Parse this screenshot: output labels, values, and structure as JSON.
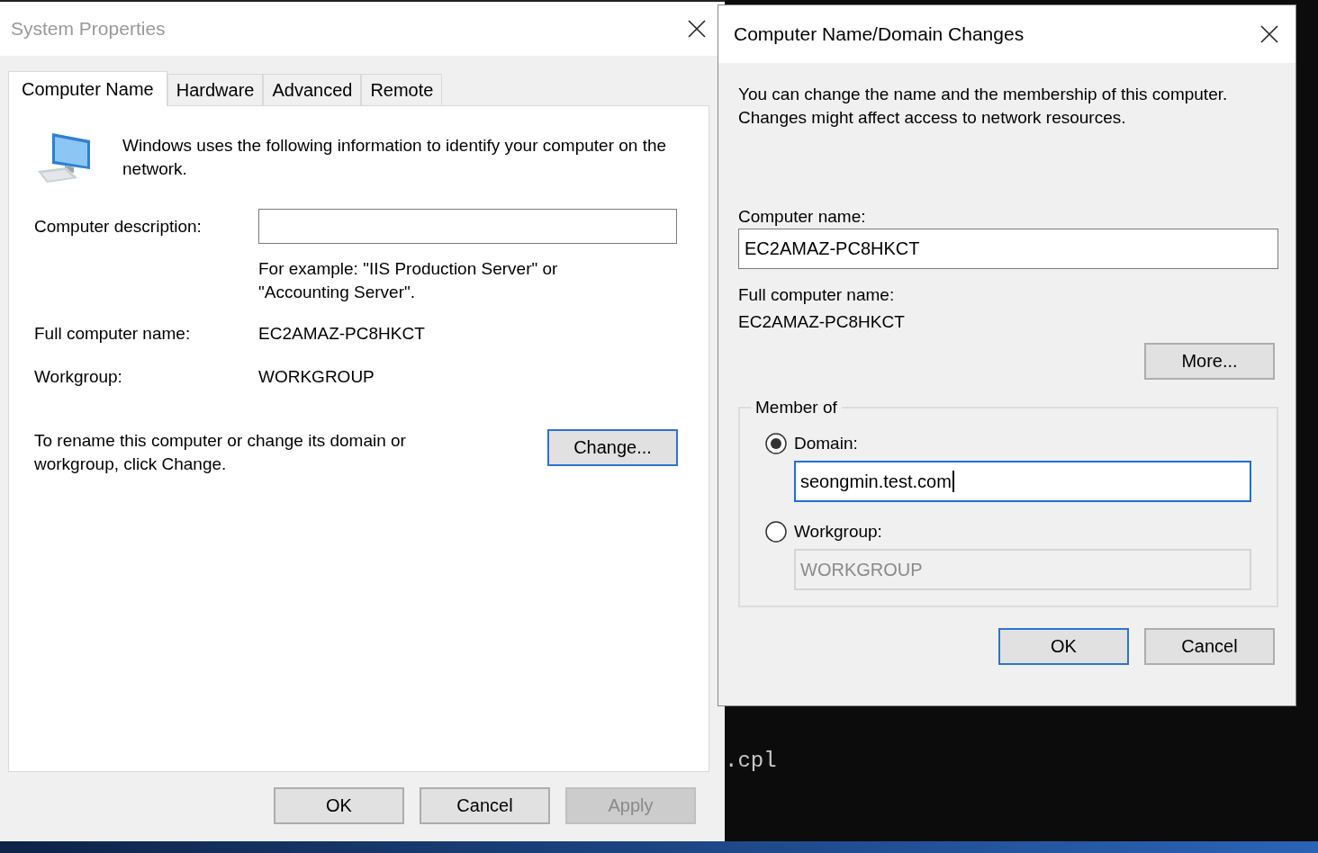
{
  "console": {
    "lines": [
      ".cpl"
    ]
  },
  "system_properties": {
    "title": "System Properties",
    "tabs": [
      {
        "label": "Computer Name",
        "selected": true
      },
      {
        "label": "Hardware",
        "selected": false
      },
      {
        "label": "Advanced",
        "selected": false
      },
      {
        "label": "Remote",
        "selected": false
      }
    ],
    "intro": "Windows uses the following information to identify your computer on the network.",
    "description": {
      "label": "Computer description:",
      "hint": "For example: \"IIS Production Server\" or \"Accounting Server\"."
    },
    "full_computer_name": {
      "label": "Full computer name:",
      "value": "EC2AMAZ-PC8HKCT"
    },
    "workgroup": {
      "label": "Workgroup:",
      "value": "WORKGROUP"
    },
    "rename_text": "To rename this computer or change its domain or workgroup, click Change.",
    "change_button": {
      "label": "Change...",
      "default": true,
      "disabled": false
    },
    "buttons": [
      {
        "label": "OK",
        "default": false,
        "disabled": false
      },
      {
        "label": "Cancel",
        "default": false,
        "disabled": false
      },
      {
        "label": "Apply",
        "default": false,
        "disabled": true
      }
    ]
  },
  "domain_dialog": {
    "title": "Computer Name/Domain Changes",
    "intro": "You can change the name and the membership of this computer. Changes might affect access to network resources.",
    "computer_name": {
      "label": "Computer name:",
      "value": "EC2AMAZ-PC8HKCT"
    },
    "full_computer_name": {
      "label": "Full computer name:",
      "value": "EC2AMAZ-PC8HKCT"
    },
    "more_button": {
      "label": "More...",
      "default": false,
      "disabled": false
    },
    "member_of": {
      "legend": "Member of",
      "options": [
        {
          "label": "Domain:",
          "selected": true,
          "value": "seongmin.test.com",
          "focused": true
        },
        {
          "label": "Workgroup:",
          "selected": false,
          "value": "WORKGROUP",
          "focused": false
        }
      ]
    },
    "buttons": [
      {
        "label": "OK",
        "default": true,
        "disabled": false
      },
      {
        "label": "Cancel",
        "default": false,
        "disabled": false
      }
    ]
  }
}
